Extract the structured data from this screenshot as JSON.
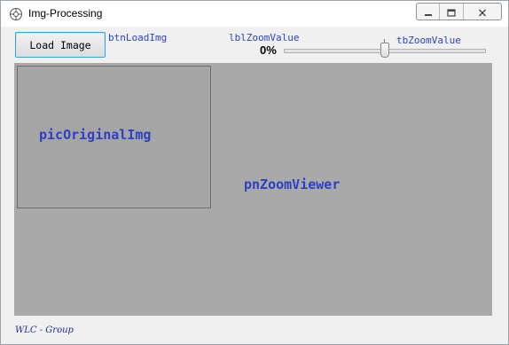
{
  "window": {
    "title": "Img-Processing"
  },
  "toolbar": {
    "load_button_label": "Load Image",
    "btn_design_name": "btnLoadImg",
    "zoom_label_design_name": "lblZoomValue",
    "zoom_value_text": "0%",
    "trackbar_design_name": "tbZoomValue",
    "trackbar_level": 0.5
  },
  "main": {
    "picture_label": "picOriginalImg",
    "panel_label": "pnZoomViewer"
  },
  "footer": {
    "text": "WLC - Group"
  },
  "colors": {
    "label_blue": "#2c40c6",
    "panel_gray": "#a9a9a9",
    "window_bg": "#f0f0f0",
    "button_border": "#3c9fd6"
  },
  "icons": [
    "app-icon",
    "minimize-icon",
    "maximize-icon",
    "close-icon"
  ]
}
